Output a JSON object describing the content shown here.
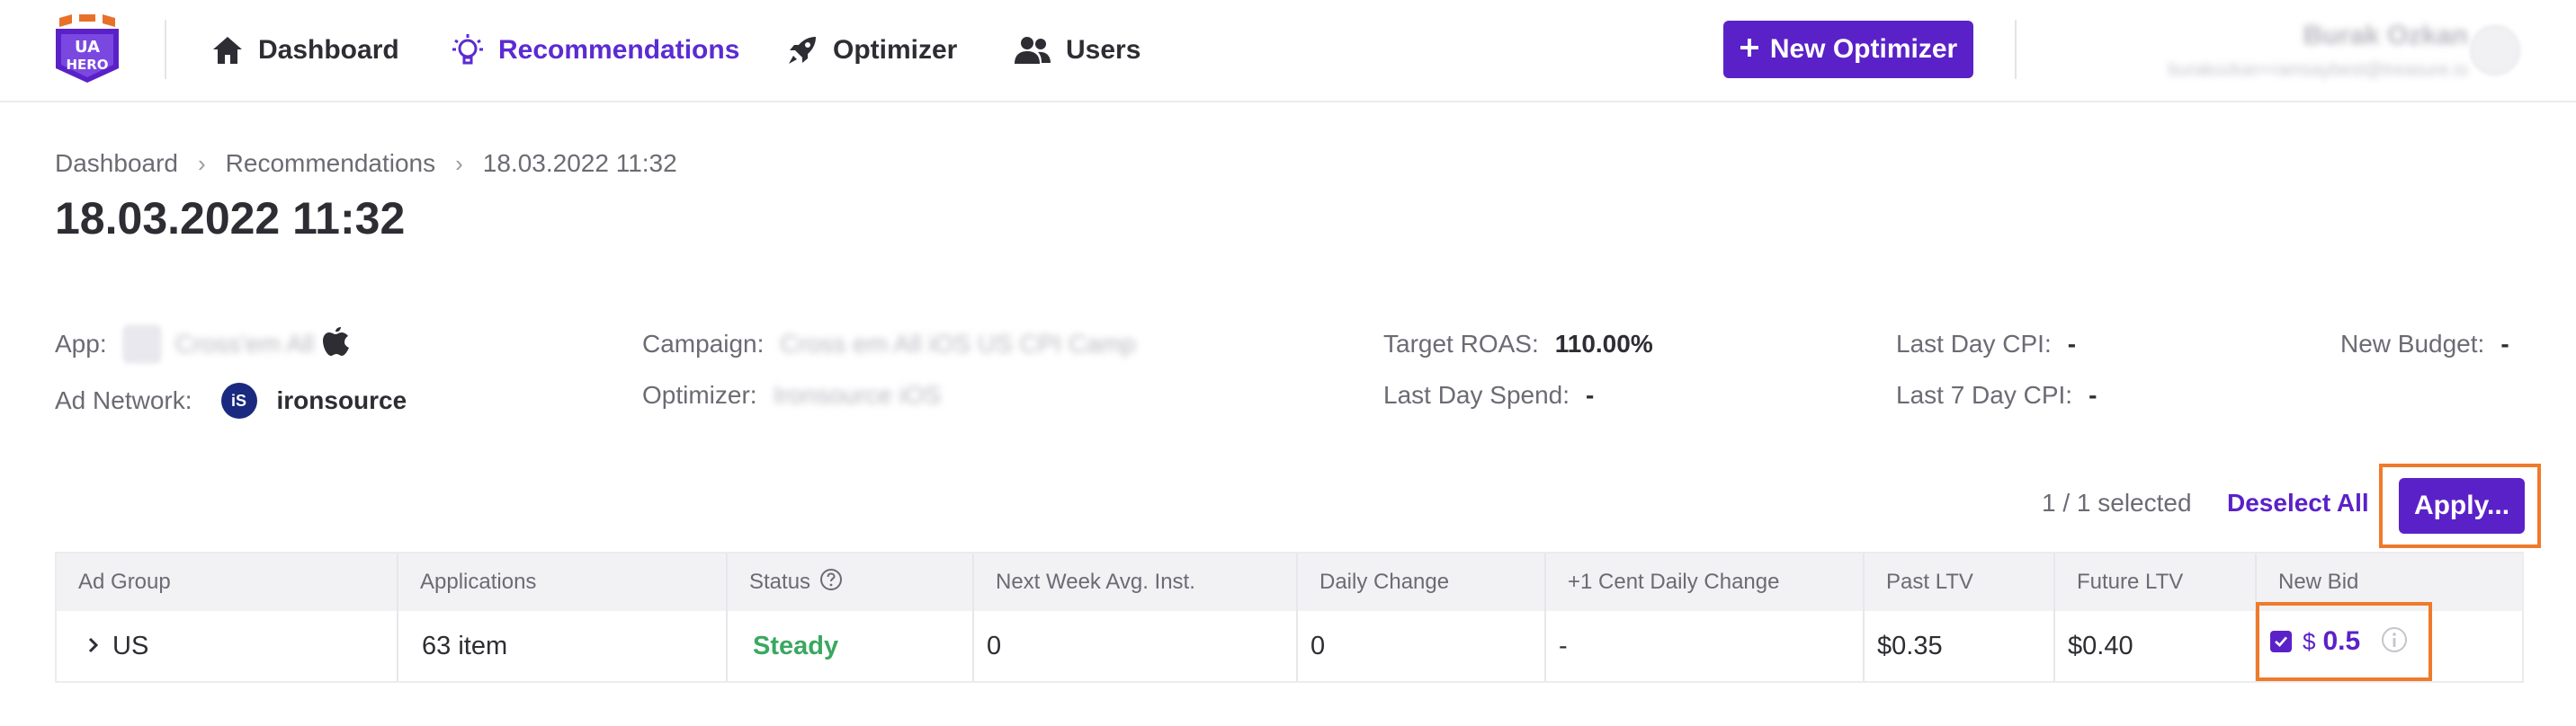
{
  "nav": {
    "dashboard": "Dashboard",
    "recommendations": "Recommendations",
    "optimizer": "Optimizer",
    "users": "Users",
    "new_optimizer": "New Optimizer"
  },
  "user": {
    "name": "Burak Ozkan",
    "email": "burakozkan+ramsaybest@treasure.io"
  },
  "breadcrumb": [
    "Dashboard",
    "Recommendations",
    "18.03.2022 11:32"
  ],
  "page_title": "18.03.2022 11:32",
  "info": {
    "app_label": "App:",
    "app_value": "Cross'em All",
    "ad_network_label": "Ad Network:",
    "ad_network_logo": "iS",
    "ad_network_value": "ironsource",
    "campaign_label": "Campaign:",
    "campaign_value": "Cross em All iOS US CPI Camp",
    "optimizer_label": "Optimizer:",
    "optimizer_value": "Ironsource iOS",
    "target_roas_label": "Target ROAS:",
    "target_roas_value": "110.00%",
    "last_day_spend_label": "Last Day Spend:",
    "last_day_spend_value": "-",
    "last_day_cpi_label": "Last Day CPI:",
    "last_day_cpi_value": "-",
    "last_7_day_cpi_label": "Last 7 Day CPI:",
    "last_7_day_cpi_value": "-",
    "new_budget_label": "New Budget:",
    "new_budget_value": "-"
  },
  "selection": {
    "count_text": "1 / 1 selected",
    "deselect_all": "Deselect All",
    "apply": "Apply..."
  },
  "table": {
    "columns": [
      "Ad Group",
      "Applications",
      "Status",
      "Next Week Avg. Inst.",
      "Daily Change",
      "+1 Cent Daily Change",
      "Past LTV",
      "Future LTV",
      "New Bid"
    ],
    "row": {
      "ad_group": "US",
      "applications": "63 item",
      "status": "Steady",
      "next_week_avg_inst": "0",
      "daily_change": "0",
      "plus_one_cent_daily_change": "-",
      "past_ltv": "$0.35",
      "future_ltv": "$0.40",
      "new_bid_currency": "$",
      "new_bid_value": "0.5",
      "new_bid_checked": true
    }
  },
  "colors": {
    "accent": "#5b21c8",
    "highlight": "#ef7a2b",
    "status_steady": "#3aa860"
  },
  "icons": {
    "nav_dashboard": "home-icon",
    "nav_recommendations": "lightbulb-icon",
    "nav_optimizer": "rocket-icon",
    "nav_users": "users-icon",
    "app_platform": "apple-icon",
    "status_help": "question-circle-icon",
    "row_expand": "chevron-right-icon",
    "bid_info": "info-circle-icon"
  }
}
